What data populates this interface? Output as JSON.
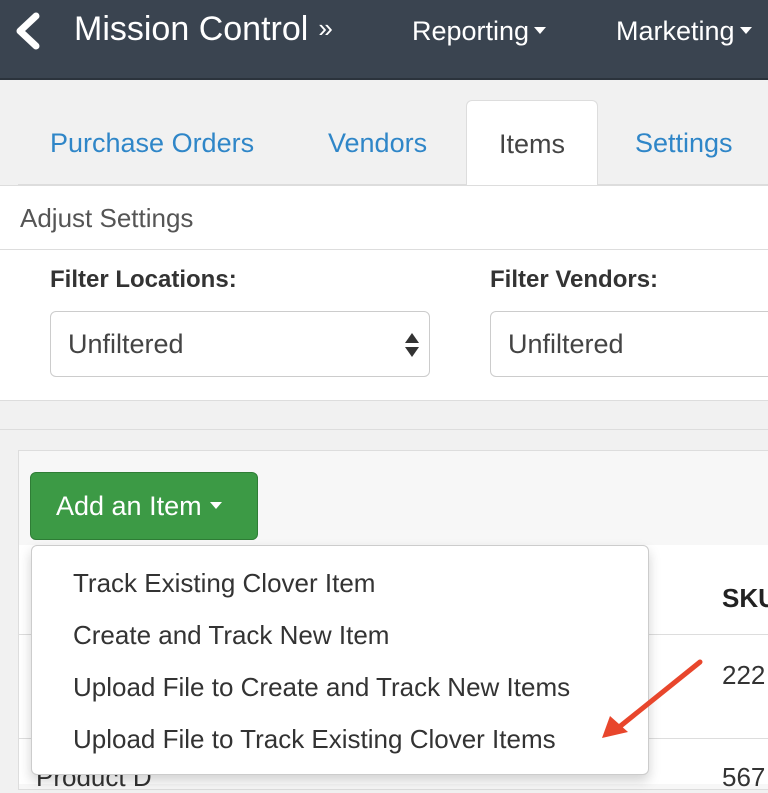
{
  "navbar": {
    "back_icon": "chevron-left-icon",
    "title": "Mission Control",
    "title_suffix": "»",
    "links": [
      {
        "label": "Reporting"
      },
      {
        "label": "Marketing"
      }
    ]
  },
  "tabs": [
    {
      "label": "Purchase Orders"
    },
    {
      "label": "Vendors"
    },
    {
      "label": "Items",
      "active": true
    },
    {
      "label": "Settings"
    }
  ],
  "settings": {
    "heading": "Adjust Settings",
    "filter_locations_label": "Filter Locations:",
    "filter_locations_value": "Unfiltered",
    "filter_vendors_label": "Filter Vendors:",
    "filter_vendors_value": "Unfiltered"
  },
  "items": {
    "add_button_label": "Add an Item",
    "dropdown_items": [
      {
        "label": "Track Existing Clover Item"
      },
      {
        "label": "Create and Track New Item"
      },
      {
        "label": "Upload File to Create and Track New Items"
      },
      {
        "label": "Upload File to Track Existing Clover Items"
      }
    ],
    "table": {
      "sku_header": "SKU",
      "rows": [
        {
          "sku": "222"
        },
        {
          "name": "Product D",
          "sku": "567"
        }
      ]
    }
  },
  "colors": {
    "navbar_bg": "#3a4450",
    "link_blue": "#2f86c8",
    "button_green": "#3c9a45",
    "annotation_arrow": "#e8462c"
  }
}
